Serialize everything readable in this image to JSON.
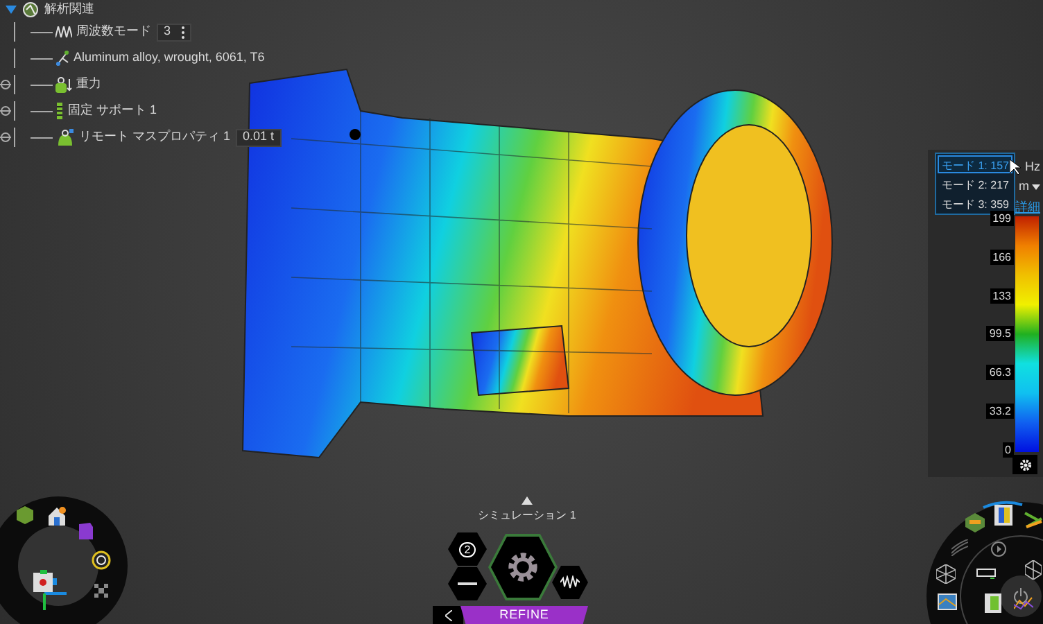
{
  "tree": {
    "root": {
      "label": "解析関連",
      "expanded": true
    },
    "items": [
      {
        "kind": "field",
        "label": "周波数モード",
        "value": "3"
      },
      {
        "kind": "text",
        "label": "Aluminum alloy, wrought, 6061, T6"
      },
      {
        "kind": "text",
        "label": "重力"
      },
      {
        "kind": "text",
        "label": "固定 サポート 1"
      },
      {
        "kind": "field",
        "label": "リモート マスプロパティ 1",
        "value": "0.01 t"
      }
    ]
  },
  "legend": {
    "modes": [
      {
        "label": "モード 1: 157",
        "selected": true
      },
      {
        "label": "モード 2: 217",
        "selected": false
      },
      {
        "label": "モード 3: 359",
        "selected": false
      }
    ],
    "unit": "Hz",
    "length_unit": "m",
    "details_link": "詳細",
    "scale": [
      "199",
      "166",
      "133",
      "99.5",
      "66.3",
      "33.2",
      "0"
    ]
  },
  "simulation": {
    "title": "シミュレーション 1",
    "badge": "2",
    "action": "REFINE"
  }
}
